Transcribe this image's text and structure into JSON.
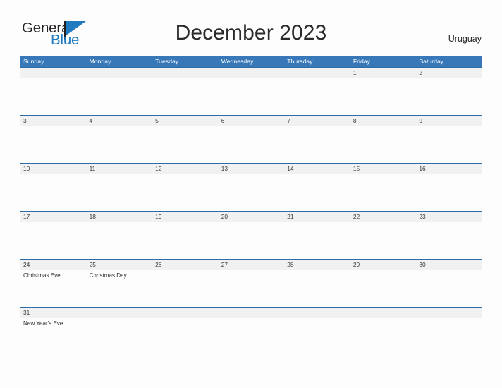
{
  "brand": {
    "name_part1": "General",
    "name_part2": "Blue",
    "flag_icon": "flag-triangle-icon",
    "color_primary": "#1f7ac0",
    "color_text": "#231f20"
  },
  "header": {
    "title": "December 2023",
    "region": "Uruguay"
  },
  "colors": {
    "header_blue": "#3878b8",
    "row_divider_blue": "#2e6da4",
    "date_band_gray": "#f1f1f1",
    "page_background": "#fdfdfd"
  },
  "calendar": {
    "day_headers": [
      "Sunday",
      "Monday",
      "Tuesday",
      "Wednesday",
      "Thursday",
      "Friday",
      "Saturday"
    ],
    "weeks": [
      {
        "days": [
          {
            "date": "",
            "events": []
          },
          {
            "date": "",
            "events": []
          },
          {
            "date": "",
            "events": []
          },
          {
            "date": "",
            "events": []
          },
          {
            "date": "",
            "events": []
          },
          {
            "date": "1",
            "events": []
          },
          {
            "date": "2",
            "events": []
          }
        ]
      },
      {
        "days": [
          {
            "date": "3",
            "events": []
          },
          {
            "date": "4",
            "events": []
          },
          {
            "date": "5",
            "events": []
          },
          {
            "date": "6",
            "events": []
          },
          {
            "date": "7",
            "events": []
          },
          {
            "date": "8",
            "events": []
          },
          {
            "date": "9",
            "events": []
          }
        ]
      },
      {
        "days": [
          {
            "date": "10",
            "events": []
          },
          {
            "date": "11",
            "events": []
          },
          {
            "date": "12",
            "events": []
          },
          {
            "date": "13",
            "events": []
          },
          {
            "date": "14",
            "events": []
          },
          {
            "date": "15",
            "events": []
          },
          {
            "date": "16",
            "events": []
          }
        ]
      },
      {
        "days": [
          {
            "date": "17",
            "events": []
          },
          {
            "date": "18",
            "events": []
          },
          {
            "date": "19",
            "events": []
          },
          {
            "date": "20",
            "events": []
          },
          {
            "date": "21",
            "events": []
          },
          {
            "date": "22",
            "events": []
          },
          {
            "date": "23",
            "events": []
          }
        ]
      },
      {
        "days": [
          {
            "date": "24",
            "events": [
              "Christmas Eve"
            ]
          },
          {
            "date": "25",
            "events": [
              "Christmas Day"
            ]
          },
          {
            "date": "26",
            "events": []
          },
          {
            "date": "27",
            "events": []
          },
          {
            "date": "28",
            "events": []
          },
          {
            "date": "29",
            "events": []
          },
          {
            "date": "30",
            "events": []
          }
        ]
      },
      {
        "days": [
          {
            "date": "31",
            "events": [
              "New Year's Eve"
            ]
          },
          {
            "date": "",
            "events": []
          },
          {
            "date": "",
            "events": []
          },
          {
            "date": "",
            "events": []
          },
          {
            "date": "",
            "events": []
          },
          {
            "date": "",
            "events": []
          },
          {
            "date": "",
            "events": []
          }
        ]
      }
    ]
  }
}
